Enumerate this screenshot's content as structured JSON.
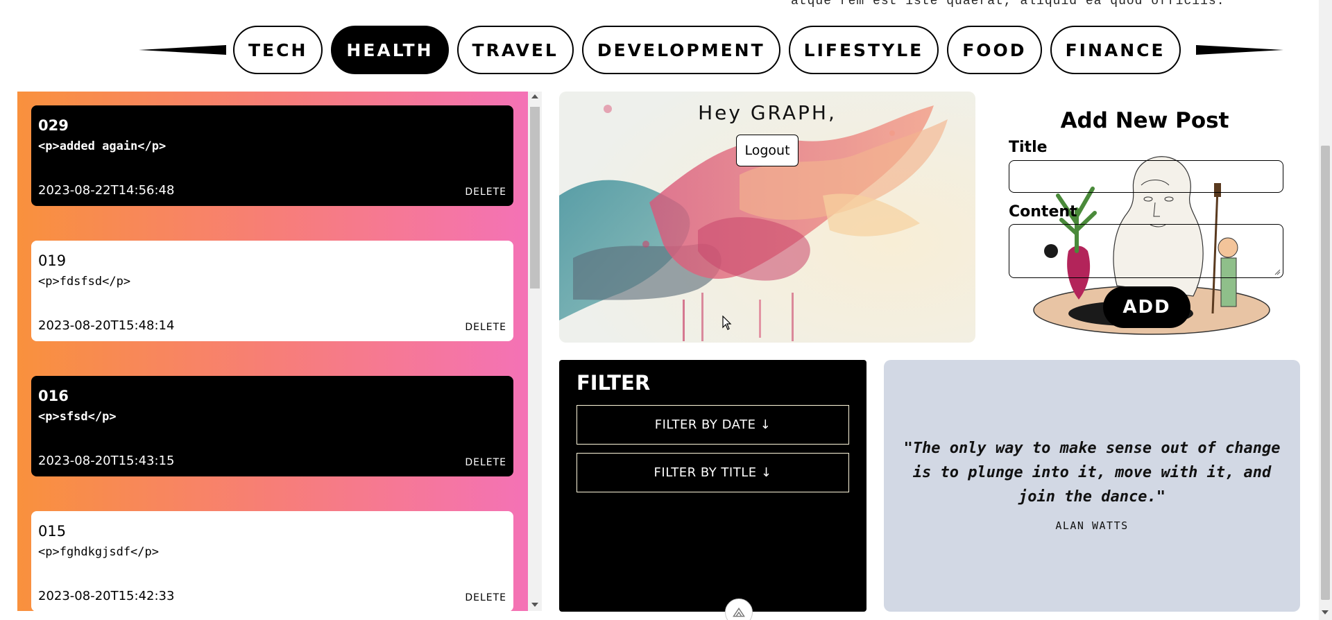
{
  "header": {
    "top_text": "atque rem est iste quaerat, aliquid ea quod officiis."
  },
  "tabs": [
    {
      "label": "TECH",
      "active": false
    },
    {
      "label": "HEALTH",
      "active": true
    },
    {
      "label": "TRAVEL",
      "active": false
    },
    {
      "label": "DEVELOPMENT",
      "active": false
    },
    {
      "label": "LIFESTYLE",
      "active": false
    },
    {
      "label": "FOOD",
      "active": false
    },
    {
      "label": "FINANCE",
      "active": false
    }
  ],
  "posts": [
    {
      "id": "029",
      "content": "<p>added again</p>",
      "date": "2023-08-22T14:56:48",
      "delete_label": "DELETE",
      "theme": "dark"
    },
    {
      "id": "019",
      "content": "<p>fdsfsd</p>",
      "date": "2023-08-20T15:48:14",
      "delete_label": "DELETE",
      "theme": "light"
    },
    {
      "id": "016",
      "content": "<p>sfsd</p>",
      "date": "2023-08-20T15:43:15",
      "delete_label": "DELETE",
      "theme": "dark"
    },
    {
      "id": "015",
      "content": "<p>fghdkgjsdf</p>",
      "date": "2023-08-20T15:42:33",
      "delete_label": "DELETE",
      "theme": "light"
    }
  ],
  "greeting": {
    "title": "Hey GRAPH,",
    "logout_label": "Logout"
  },
  "add_post": {
    "heading": "Add New Post",
    "title_label": "Title",
    "title_value": "",
    "content_label": "Content",
    "content_value": "",
    "submit_label": "ADD"
  },
  "filter": {
    "heading": "FILTER",
    "by_date_label": "FILTER BY DATE ↓",
    "by_title_label": "FILTER BY TITLE ↓"
  },
  "quote": {
    "text": "\"The only way to make sense out of change is to plunge into it, move with it, and join the dance.\"",
    "author": "ALAN WATTS"
  },
  "colors": {
    "gradient_start": "#f9913d",
    "gradient_end": "#f472b6",
    "quote_bg": "#d2d8e4",
    "accent": "#000000"
  }
}
